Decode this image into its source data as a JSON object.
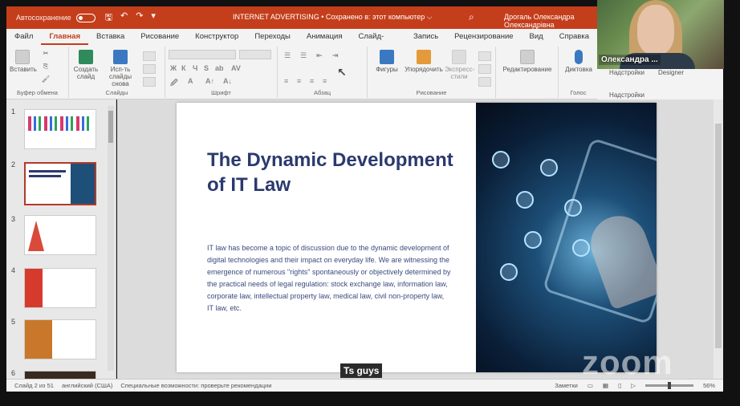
{
  "titlebar": {
    "autosave": "Автосохранение",
    "document": "INTERNET ADVERTISING • Сохранено в: этот компьютер ⌵",
    "user": "Дрогаль Олександра Олександрівна"
  },
  "tabs": [
    "Файл",
    "Главная",
    "Вставка",
    "Рисование",
    "Конструктор",
    "Переходы",
    "Анимация",
    "Слайд-шоу",
    "Запись",
    "Рецензирование",
    "Вид",
    "Справка"
  ],
  "ribbon": {
    "paste": "Вставить",
    "clipboard": "Буфер обмена",
    "create_slide": "Создать слайд",
    "reuse": "Исп-ть слайды снова",
    "slides": "Слайды",
    "font": "Шрифт",
    "paragraph": "Абзац",
    "shapes": "Фигуры",
    "arrange": "Упорядочить",
    "styles": "Экспресс-стили",
    "drawing": "Рисование",
    "editing": "Редактирование",
    "dictation": "Диктовка",
    "voice": "Голос",
    "addins": "Надстройки",
    "designer": "Designer"
  },
  "webcam": {
    "name": "Олександра ..."
  },
  "thumbnails": [
    "1",
    "2",
    "3",
    "4",
    "5",
    "6"
  ],
  "slide": {
    "title": "The Dynamic Development of IT Law",
    "body": "IT law has become a topic of discussion due to the dynamic development of digital technologies and their impact on everyday life. We are witnessing the emergence of numerous \"rights\" spontaneously or objectively determined by the practical needs of legal regulation: stock exchange law, information law, corporate law, intellectual property law, medical law, civil non-property law, IT law, etc."
  },
  "caption": "Ts guys",
  "zoom_watermark": "zoom",
  "status": {
    "slide": "Слайд 2 из 51",
    "language": "английский (США)",
    "accessibility": "Специальные возможности: проверьте рекомендации",
    "notes": "Заметки",
    "zoom": "56%"
  }
}
